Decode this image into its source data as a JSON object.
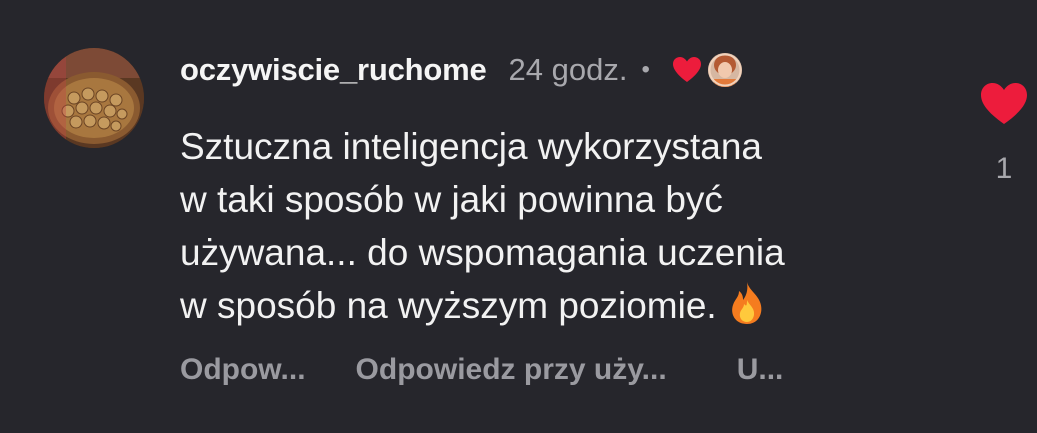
{
  "comment": {
    "username": "oczywiscie_ruchome",
    "time": "24 godz.",
    "separator": "•",
    "avatar_icon": "walnuts-basket-photo",
    "author_liked_icon": "heart-icon",
    "author_avatar_icon": "author-avatar-photo",
    "text_lines": [
      "Sztuczna inteligencja wykorzystana",
      "w taki sposób w jaki powinna być",
      "używana... do wspomagania uczenia",
      "w sposób na wyższym poziomie."
    ],
    "emoji": "fire-icon",
    "actions": {
      "reply": "Odpow...",
      "reply_ai": "Odpowiedz przy uży...",
      "more": "U..."
    },
    "likes": {
      "icon": "heart-icon",
      "count": "1"
    }
  },
  "colors": {
    "background": "#26262c",
    "heart": "#ed1c3c",
    "text": "#f2f2f2",
    "muted": "#a8a8ad"
  }
}
